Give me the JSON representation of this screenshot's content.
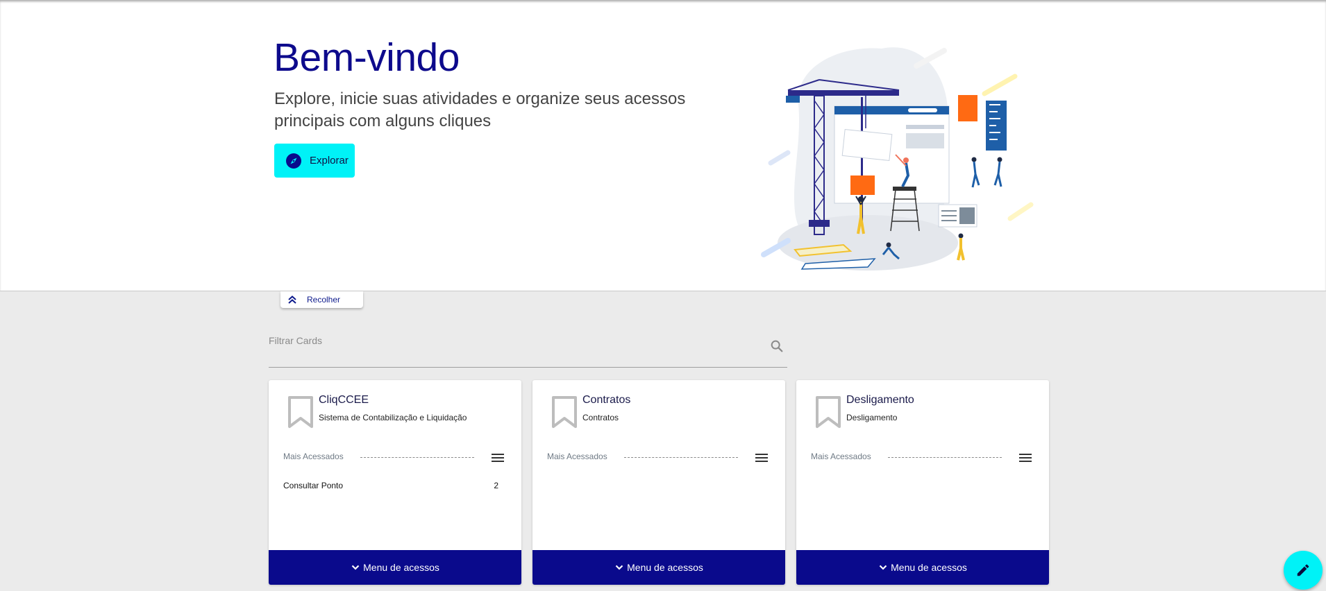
{
  "hero": {
    "title": "Bem-vindo",
    "subtitle": "Explore, inicie suas atividades e organize seus acessos principais com alguns cliques",
    "explore_label": "Explorar",
    "collapse_label": "Recolher",
    "illustration": "construction-team-illustration"
  },
  "filter": {
    "placeholder": "Filtrar Cards",
    "value": ""
  },
  "cards": [
    {
      "title": "CliqCCEE",
      "subtitle": "Sistema de Contabilização e Liquidação",
      "most_accessed_label": "Mais Acessados",
      "items": [
        {
          "label": "Consultar Ponto",
          "count": "2"
        }
      ],
      "menu_label": "Menu de acessos"
    },
    {
      "title": "Contratos",
      "subtitle": "Contratos",
      "most_accessed_label": "Mais Acessados",
      "items": [],
      "menu_label": "Menu de acessos"
    },
    {
      "title": "Desligamento",
      "subtitle": "Desligamento",
      "most_accessed_label": "Mais Acessados",
      "items": [],
      "menu_label": "Menu de acessos"
    }
  ],
  "colors": {
    "primary": "#0a0a8c",
    "accent": "#00f2f7",
    "title": "#0d0a8c",
    "background": "#ebebeb"
  },
  "icons": {
    "explore": "compass-icon",
    "collapse": "double-chevron-up-icon",
    "search": "search-icon",
    "card": "bookmark-icon",
    "menu": "menu-icon",
    "access": "chevron-down-icon",
    "fab": "pencil-icon"
  }
}
